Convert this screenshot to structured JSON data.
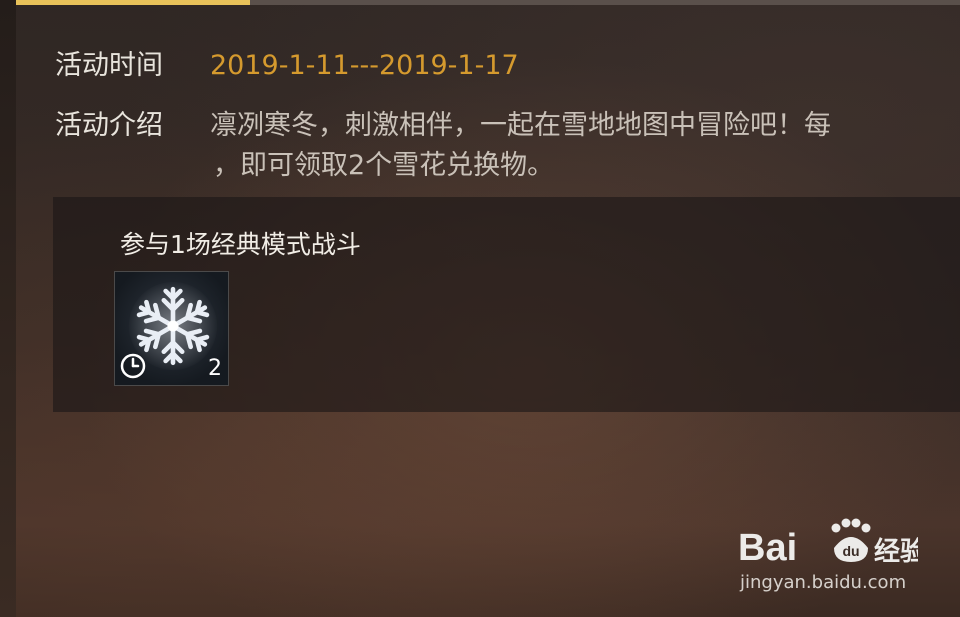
{
  "event": {
    "time_label": "活动时间",
    "time_value": "2019-1-11---2019-1-17",
    "intro_label": "活动介绍",
    "intro_line1": "凛冽寒冬，刺激相伴，一起在雪地地图中冒险吧！每",
    "intro_line2": "，即可领取2个雪花兑换物。"
  },
  "task": {
    "title": "参与1场经典模式战斗",
    "reward": {
      "icon": "snowflake-icon",
      "quantity": "2",
      "timed_icon": "clock-icon"
    }
  },
  "watermark": {
    "brand_left": "Bai",
    "brand_paw": "du",
    "brand_right": "经验",
    "url": "jingyan.baidu.com"
  },
  "colors": {
    "accent": "#e8c25a",
    "time_value": "#d59a2e"
  }
}
